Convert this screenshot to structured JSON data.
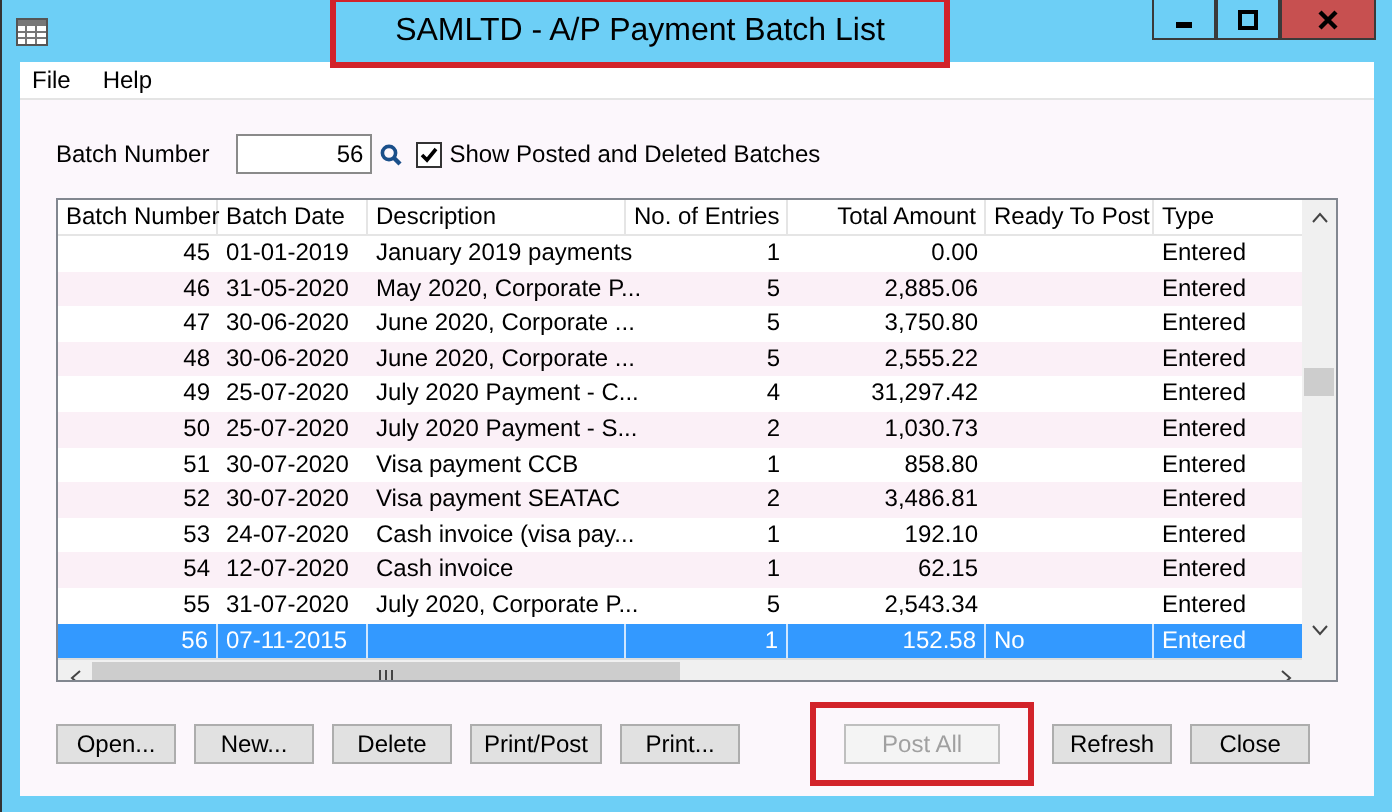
{
  "window": {
    "title": "SAMLTD - A/P Payment Batch List",
    "title_highlighted": true
  },
  "menu": [
    "File",
    "Help"
  ],
  "filter": {
    "label": "Batch Number",
    "value": "56",
    "checkbox_label": "Show Posted and Deleted Batches",
    "checked": true
  },
  "table": {
    "columns": [
      "Batch Number",
      "Batch Date",
      "Description",
      "No. of Entries",
      "Total Amount",
      "Ready To Post",
      "Type"
    ],
    "rows": [
      {
        "cells": [
          "45",
          "01-01-2019",
          "January 2019 payments",
          "1",
          "0.00",
          "",
          "Entered"
        ],
        "selected": false
      },
      {
        "cells": [
          "46",
          "31-05-2020",
          "May 2020, Corporate P...",
          "5",
          "2,885.06",
          "",
          "Entered"
        ],
        "selected": false
      },
      {
        "cells": [
          "47",
          "30-06-2020",
          "June 2020, Corporate ...",
          "5",
          "3,750.80",
          "",
          "Entered"
        ],
        "selected": false
      },
      {
        "cells": [
          "48",
          "30-06-2020",
          "June 2020, Corporate ...",
          "5",
          "2,555.22",
          "",
          "Entered"
        ],
        "selected": false
      },
      {
        "cells": [
          "49",
          "25-07-2020",
          "July 2020 Payment - C...",
          "4",
          "31,297.42",
          "",
          "Entered"
        ],
        "selected": false
      },
      {
        "cells": [
          "50",
          "25-07-2020",
          "July 2020 Payment - S...",
          "2",
          "1,030.73",
          "",
          "Entered"
        ],
        "selected": false
      },
      {
        "cells": [
          "51",
          "30-07-2020",
          "Visa payment CCB",
          "1",
          "858.80",
          "",
          "Entered"
        ],
        "selected": false
      },
      {
        "cells": [
          "52",
          "30-07-2020",
          "Visa payment SEATAC",
          "2",
          "3,486.81",
          "",
          "Entered"
        ],
        "selected": false
      },
      {
        "cells": [
          "53",
          "24-07-2020",
          "Cash invoice (visa pay...",
          "1",
          "192.10",
          "",
          "Entered"
        ],
        "selected": false
      },
      {
        "cells": [
          "54",
          "12-07-2020",
          "Cash invoice",
          "1",
          "62.15",
          "",
          "Entered"
        ],
        "selected": false
      },
      {
        "cells": [
          "55",
          "31-07-2020",
          "July 2020, Corporate P...",
          "5",
          "2,543.34",
          "",
          "Entered"
        ],
        "selected": false
      },
      {
        "cells": [
          "56",
          "07-11-2015",
          "",
          "1",
          "152.58",
          "No",
          "Entered"
        ],
        "selected": true
      }
    ]
  },
  "buttons": [
    {
      "label": "Open...",
      "disabled": false,
      "highlighted": false
    },
    {
      "label": "New...",
      "disabled": false,
      "highlighted": false
    },
    {
      "label": "Delete",
      "disabled": false,
      "highlighted": false
    },
    {
      "label": "Print/Post",
      "disabled": false,
      "highlighted": false
    },
    {
      "label": "Print...",
      "disabled": false,
      "highlighted": false
    },
    {
      "label": "Post All",
      "disabled": true,
      "highlighted": true
    },
    {
      "label": "Refresh",
      "disabled": false,
      "highlighted": false
    },
    {
      "label": "Close",
      "disabled": false,
      "highlighted": false
    }
  ]
}
